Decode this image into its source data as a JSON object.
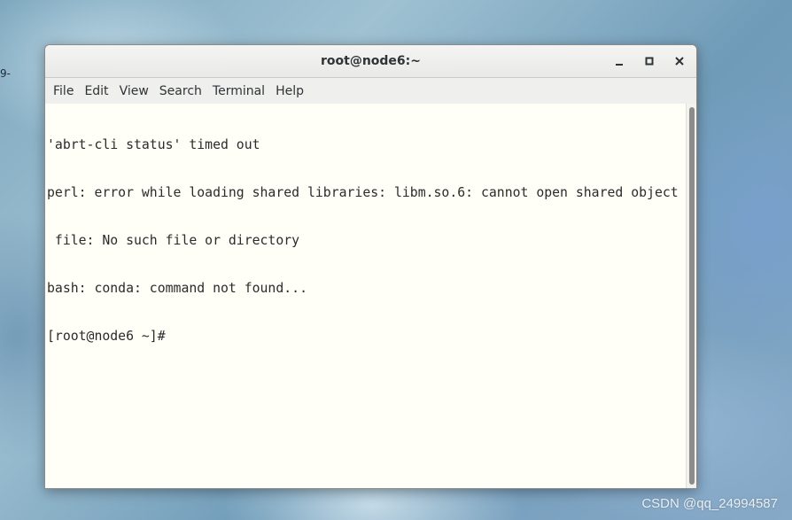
{
  "desktop": {
    "fragment_text": "9-",
    "watermark": "CSDN @qq_24994587"
  },
  "window": {
    "title": "root@node6:~",
    "controls": {
      "minimize_icon": "minimize-icon",
      "maximize_icon": "maximize-icon",
      "close_icon": "close-icon"
    }
  },
  "menubar": {
    "items": [
      "File",
      "Edit",
      "View",
      "Search",
      "Terminal",
      "Help"
    ]
  },
  "terminal": {
    "lines": [
      "'abrt-cli status' timed out",
      "perl: error while loading shared libraries: libm.so.6: cannot open shared object",
      " file: No such file or directory",
      "bash: conda: command not found...",
      "[root@node6 ~]#"
    ]
  },
  "colors": {
    "terminal_background": "#fffff8",
    "terminal_text": "#2b2b2b",
    "titlebar": "#efefed"
  }
}
